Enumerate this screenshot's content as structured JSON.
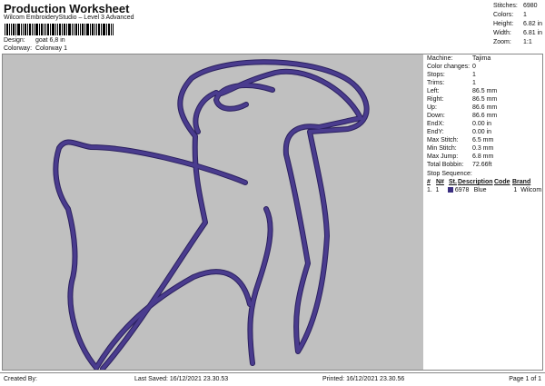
{
  "header": {
    "title": "Production Worksheet",
    "subtitle": "Wilcom EmbroideryStudio – Level 3 Advanced"
  },
  "design": {
    "label": "Design:",
    "value": "goat 6,8 in"
  },
  "colorway": {
    "label": "Colorway:",
    "value": "Colorway 1"
  },
  "stats": [
    {
      "label": "Stitches:",
      "value": "6980"
    },
    {
      "label": "Colors:",
      "value": "1"
    },
    {
      "label": "Height:",
      "value": "6.82 in"
    },
    {
      "label": "Width:",
      "value": "6.81 in"
    },
    {
      "label": "Zoom:",
      "value": "1:1"
    }
  ],
  "machine_info": [
    {
      "label": "Machine:",
      "value": "Tajima"
    },
    {
      "label": "Color changes:",
      "value": "0"
    },
    {
      "label": "Stops:",
      "value": "1"
    },
    {
      "label": "Trims:",
      "value": "1"
    },
    {
      "label": "Left:",
      "value": "86.5 mm"
    },
    {
      "label": "Right:",
      "value": "86.5 mm"
    },
    {
      "label": "Up:",
      "value": "86.6 mm"
    },
    {
      "label": "Down:",
      "value": "86.6 mm"
    },
    {
      "label": "EndX:",
      "value": "0.00 in"
    },
    {
      "label": "EndY:",
      "value": "0.00 in"
    },
    {
      "label": "Max Stitch:",
      "value": "6.5 mm"
    },
    {
      "label": "Min Stitch:",
      "value": "0.3 mm"
    },
    {
      "label": "Max Jump:",
      "value": "6.8 mm"
    },
    {
      "label": "Total Bobbin:",
      "value": "72.66ft"
    }
  ],
  "stop_sequence": {
    "title": "Stop Sequence:",
    "columns": [
      "#",
      "N#",
      "St.",
      "Description",
      "Code",
      "Brand"
    ],
    "rows": [
      {
        "idx": "1.",
        "n": "1",
        "st": "6978",
        "description": "Blue",
        "code": "1",
        "brand": "Wilcom"
      }
    ]
  },
  "colors": {
    "canvas": "#c0c0c0",
    "thread": "#4a3c8e",
    "thread_edge": "#2a1f5e"
  },
  "footer": {
    "created_by": "Created By:",
    "last_saved": "Last Saved: 16/12/2021 23.30.53",
    "printed": "Printed: 16/12/2021 23.30.56",
    "page": "Page 1 of 1"
  }
}
